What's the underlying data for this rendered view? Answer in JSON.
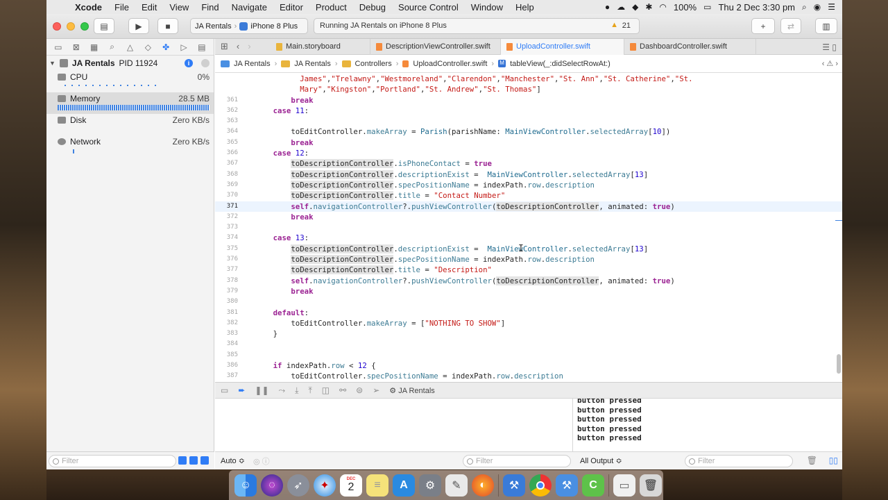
{
  "menubar": {
    "apple": "",
    "items": [
      "Xcode",
      "File",
      "Edit",
      "View",
      "Find",
      "Navigate",
      "Editor",
      "Product",
      "Debug",
      "Source Control",
      "Window",
      "Help"
    ],
    "battery": "100%",
    "clock": "Thu 2 Dec  3:30 pm"
  },
  "toolbar": {
    "scheme_project": "JA Rentals",
    "scheme_device": "iPhone 8 Plus",
    "activity_status": "Running JA Rentals on iPhone 8 Plus",
    "warning_count": "21"
  },
  "navigator": {
    "process_name": "JA Rentals",
    "process_pid": "PID 11924",
    "gauges": [
      {
        "name": "CPU",
        "value": "0%"
      },
      {
        "name": "Memory",
        "value": "28.5 MB"
      },
      {
        "name": "Disk",
        "value": "Zero KB/s"
      },
      {
        "name": "Network",
        "value": "Zero KB/s"
      }
    ],
    "filter_placeholder": "Filter"
  },
  "editor": {
    "tabs": [
      "Main.storyboard",
      "DescriptionViewController.swift",
      "UploadController.swift",
      "DashboardController.swift"
    ],
    "active_tab": "UploadController.swift",
    "breadcrumb": [
      "JA Rentals",
      "JA Rentals",
      "Controllers",
      "UploadController.swift",
      "tableView(_:didSelectRowAt:)"
    ],
    "current_line": "371"
  },
  "debug": {
    "process": "JA Rentals",
    "console_lines": [
      "button pressed",
      "button pressed",
      "button pressed",
      "button pressed",
      "button pressed"
    ],
    "variables_scope": "Auto ≎",
    "output_scope": "All Output ≎",
    "filter_placeholder": "Filter"
  },
  "dock": {
    "apps": [
      "Finder",
      "Siri",
      "Launchpad",
      "Safari",
      "Calendar",
      "Notes",
      "App Store",
      "System Preferences",
      "TextEdit",
      "Firefox",
      "Xcode",
      "Chrome",
      "Xcode Simulator",
      "Android Studio",
      "Folder",
      "Trash"
    ],
    "calendar_month": "DEC",
    "calendar_day": "2"
  }
}
